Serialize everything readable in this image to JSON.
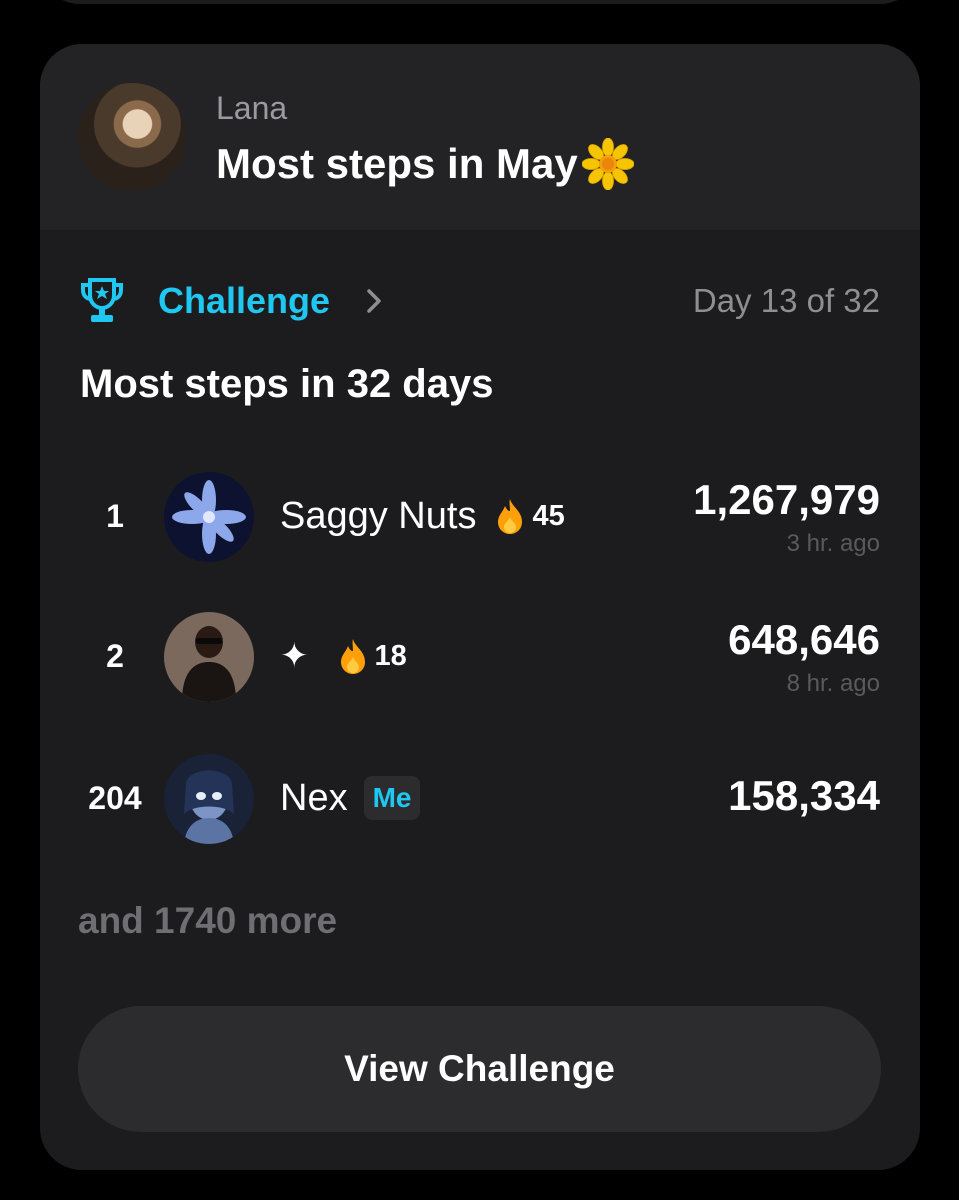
{
  "post": {
    "author": "Lana",
    "title": "Most steps in May",
    "title_emoji": "sunflower-icon"
  },
  "challenge": {
    "label": "Challenge",
    "day_progress": "Day 13 of 32",
    "title": "Most steps in 32 days"
  },
  "leaderboard": [
    {
      "rank": "1",
      "name": "Saggy Nuts",
      "streak": "45",
      "steps": "1,267,979",
      "ago": "3 hr. ago"
    },
    {
      "rank": "2",
      "name": "✦",
      "streak": "18",
      "steps": "648,646",
      "ago": "8 hr. ago"
    },
    {
      "rank": "204",
      "name": "Nex",
      "badge": "Me",
      "steps": "158,334"
    }
  ],
  "more_label": "and 1740 more",
  "button_label": "View Challenge",
  "colors": {
    "accent": "#1ec8f2",
    "card_bg": "#1c1c1e",
    "header_bg": "#232325",
    "muted": "#8e8e93",
    "button_bg": "#2c2c2e",
    "fire": "#ff9f0a"
  }
}
